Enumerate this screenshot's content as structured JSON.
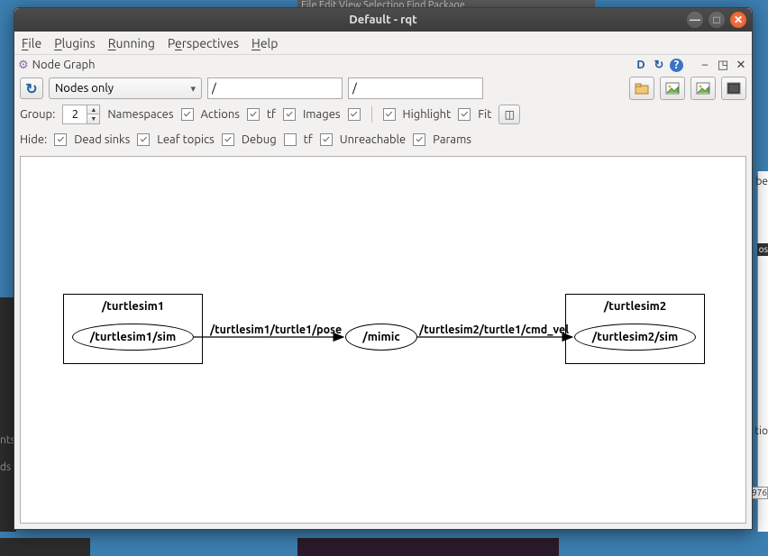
{
  "background": {
    "top_menu_fragment": "File  Edit  View  Selection  Find  Package",
    "left_frag1": "nts",
    "left_frag2": "ds",
    "right_frag1": "be",
    "right_frag2": "os",
    "right_frag3": "tio",
    "right_frag4": "976"
  },
  "window": {
    "title": "Default - rqt",
    "controls": {
      "min": "—",
      "max": "□",
      "close": "✕"
    }
  },
  "menubar": {
    "file": "File",
    "plugins": "Plugins",
    "running": "Running",
    "perspectives": "Perspectives",
    "help": "Help"
  },
  "plugin": {
    "title": "Node Graph",
    "icons": {
      "d": "D",
      "reload": "↻",
      "help": "?",
      "min": "–",
      "undock": "◳",
      "close": "✕"
    }
  },
  "toolbar": {
    "refresh": "↻",
    "mode": "Nodes only",
    "filter1": "/",
    "filter2": "/",
    "save_icon": "folder",
    "img1": "img",
    "img2": "img",
    "full": "■"
  },
  "group": {
    "label": "Group:",
    "value": "2",
    "namespaces_label": "Namespaces",
    "namespaces": true,
    "actions_label": "Actions",
    "actions": true,
    "tf_label": "tf",
    "tf": true,
    "images_label": "Images",
    "images": true,
    "highlight_label": "Highlight",
    "highlight": true,
    "fit_label": "Fit",
    "fit": true,
    "extra_btn": "◫"
  },
  "hide": {
    "label": "Hide:",
    "dead_label": "Dead sinks",
    "dead": true,
    "leaf_label": "Leaf topics",
    "leaf": true,
    "debug_label": "Debug",
    "debug": true,
    "tf_label": "tf",
    "tf": false,
    "unreachable_label": "Unreachable",
    "unreachable": true,
    "params_label": "Params",
    "params": true
  },
  "graph": {
    "ns1": {
      "title": "/turtlesim1",
      "node": "/turtlesim1/sim"
    },
    "ns2": {
      "title": "/turtlesim2",
      "node": "/turtlesim2/sim"
    },
    "mimic": "/mimic",
    "edge1": "/turtlesim1/turtle1/pose",
    "edge2": "/turtlesim2/turtle1/cmd_vel"
  }
}
